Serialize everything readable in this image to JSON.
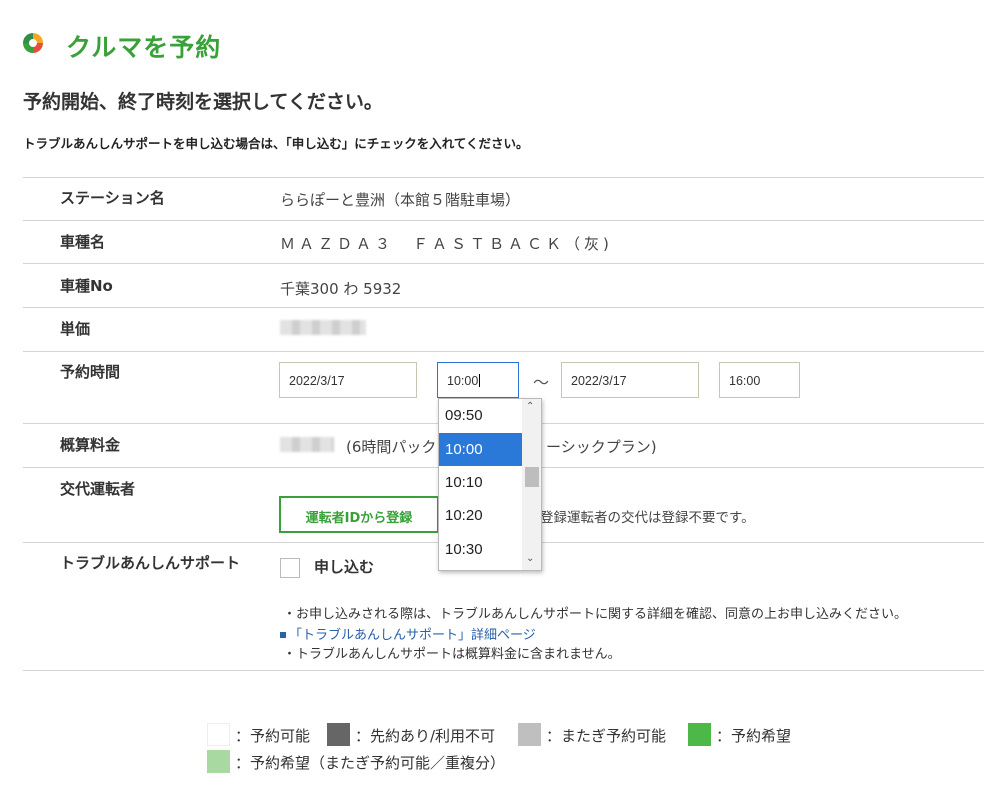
{
  "header": {
    "title": "クルマを予約",
    "subtitle": "予約開始、終了時刻を選択してください。",
    "notice": "トラブルあんしんサポートを申し込む場合は、「申し込む」にチェックを入れてください。"
  },
  "rows": {
    "station": {
      "label": "ステーション名",
      "value": "ららぽーと豊洲（本館５階駐車場）"
    },
    "model": {
      "label": "車種名",
      "value": "ＭＡＺＤＡ３　ＦＡＳＴＢＡＣＫ（灰)"
    },
    "car_no": {
      "label": "車種No",
      "value": "千葉300 わ 5932"
    },
    "unit_price": {
      "label": "単価"
    },
    "reservation": {
      "label": "予約時間",
      "start_date": "2022/3/17",
      "start_time": "10:00",
      "separator": "〜",
      "end_date": "2022/3/17",
      "end_time": "16:00"
    },
    "estimate": {
      "label": "概算料金",
      "value_part1": "(6時間パック",
      "value_part2": "ーシックプラン)"
    },
    "driver": {
      "label": "交代運転者",
      "button": "運転者IDから登録",
      "note": "登録運転者の交代は登録不要です。"
    },
    "support": {
      "label": "トラブルあんしんサポート",
      "checkbox_label": "申し込む",
      "note1": "・お申し込みされる際は、トラブルあんしんサポートに関する詳細を確認、同意の上お申し込みください。",
      "link": "「トラブルあんしんサポート」詳細ページ",
      "note2": "・トラブルあんしんサポートは概算料金に含まれません。"
    }
  },
  "dropdown": {
    "options": [
      "09:50",
      "10:00",
      "10:10",
      "10:20",
      "10:30"
    ],
    "selected": "10:00"
  },
  "legend": {
    "available": "：予約可能",
    "booked": "：先約あり/利用不可",
    "span": "：またぎ予約可能",
    "desired": "：予約希望",
    "desired_span": "：予約希望（またぎ予約可能／重複分）"
  },
  "colors": {
    "brand_green": "#3aa13a",
    "select_blue": "#2a78d8",
    "legend_available": "#ffffff",
    "legend_booked": "#666666",
    "legend_span": "#bfbfbf",
    "legend_desired": "#4cb848",
    "legend_desired_span": "#a8d9a0"
  }
}
